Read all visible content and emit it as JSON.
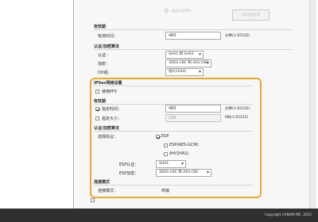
{
  "top": {
    "radio_label": "使用共享密钥",
    "button_label": "共享密钥设置"
  },
  "effective_period_1": {
    "title": "有效期",
    "time_label": "有效时间：",
    "time_value": "480",
    "time_unit": "分钟(1-65535)"
  },
  "auth_encrypt_1": {
    "title": "认证/加密算法",
    "auth_label": "认证：",
    "auth_value": "SHA1 和 SHA2",
    "encrypt_label": "加密：",
    "encrypt_value": "3DES-CBC 和 AES-CBC",
    "dh_label": "DH组：",
    "dh_value": "组2(1024)"
  },
  "ipsec": {
    "title": "IPSec网络设置",
    "pfs_label": "使用PFS",
    "period": {
      "title": "有效期",
      "time_label": "指定时间：",
      "time_value": "480",
      "time_unit": "分钟(1-65535)",
      "size_label": "指定大小：",
      "size_value": "100",
      "size_unit": "MB(1-65535)"
    },
    "auth": {
      "title": "认证/加密算法",
      "protocol_label": "选择协议：",
      "esp_label": "ESP",
      "esp_aes_label": "ESP(AES-GCM)",
      "ah_label": "AH(SHA1)",
      "esp_auth_label": "ESP认证：",
      "esp_auth_value": "SHA1",
      "esp_encrypt_label": "ESP加密：",
      "esp_encrypt_value": "3DES-CBC 和 AES-CBC"
    },
    "conn": {
      "title": "连接模式",
      "mode_label": "连接模式：",
      "mode_value": "传输"
    }
  },
  "footer": {
    "copyright": "Copyright CANON INC. 2015"
  }
}
